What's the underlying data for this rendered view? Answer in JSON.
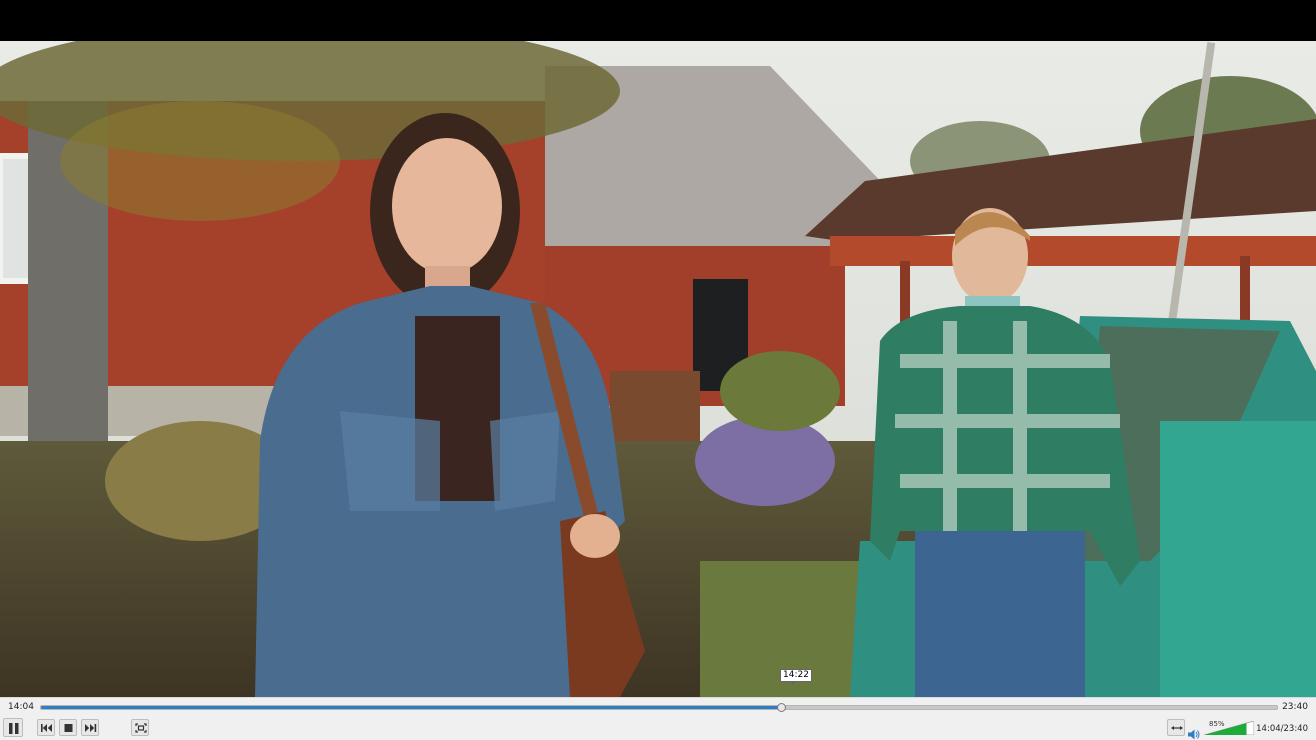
{
  "player": {
    "hover_time": "14:22",
    "elapsed": "14:04",
    "total": "23:40",
    "readout": "14:04/23:40",
    "progress_fraction": 0.599,
    "volume_label": "85%",
    "volume_fraction": 0.85,
    "accent_color": "#2f7dc3",
    "volume_color": "#1faa3c"
  },
  "buttons": {
    "play_pause_icon": "pause-icon",
    "previous_icon": "previous-icon",
    "stop_icon": "stop-icon",
    "next_icon": "next-icon",
    "fullscreen_icon": "fullscreen-icon",
    "loop_icon": "loop-icon",
    "volume_icon": "speaker-icon"
  }
}
